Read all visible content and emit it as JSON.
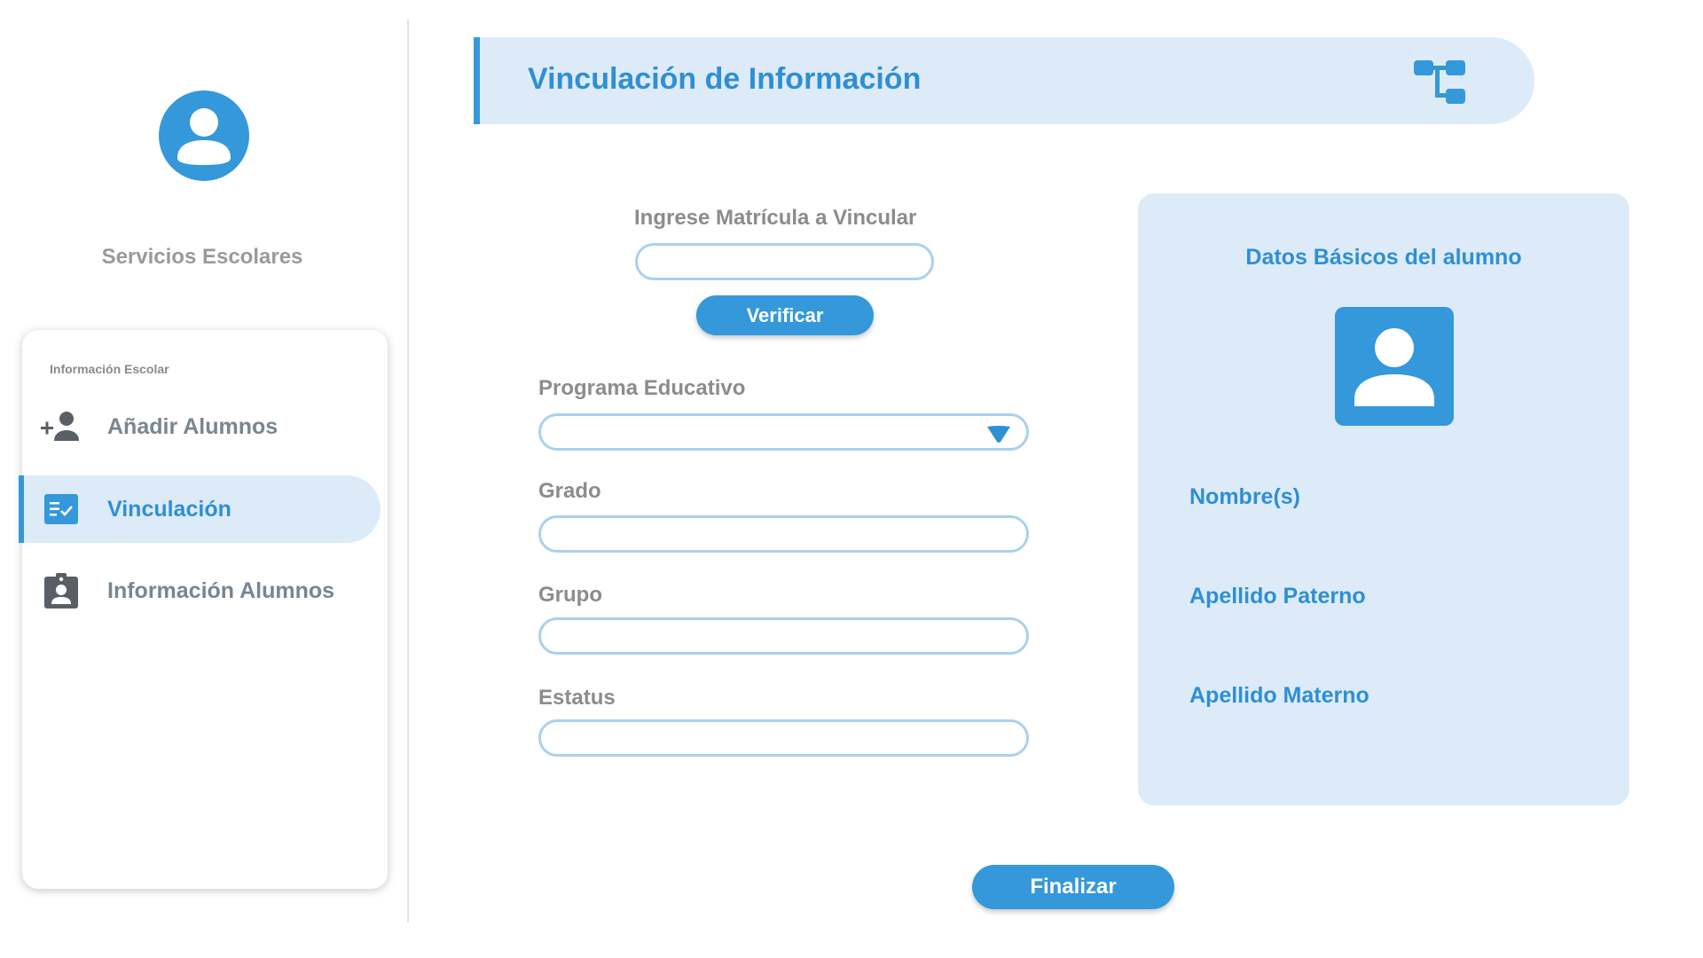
{
  "sidebar": {
    "app_name": "Servicios Escolares",
    "menu": {
      "section_title": "Información Escolar",
      "items": [
        {
          "label": "Añadir Alumnos",
          "icon": "add-person-icon",
          "active": false
        },
        {
          "label": "Vinculación",
          "icon": "checklist-icon",
          "active": true
        },
        {
          "label": "Información Alumnos",
          "icon": "badge-person-icon",
          "active": false
        }
      ]
    }
  },
  "header": {
    "title": "Vinculación de Información",
    "icon": "hierarchy-icon"
  },
  "form": {
    "matricula_label": "Ingrese Matrícula a Vincular",
    "matricula_value": "",
    "verify_button": "Verificar",
    "programa_label": "Programa Educativo",
    "programa_value": "",
    "grado_label": "Grado",
    "grado_value": "",
    "grupo_label": "Grupo",
    "grupo_value": "",
    "estatus_label": "Estatus",
    "estatus_value": "",
    "finish_button": "Finalizar"
  },
  "student_card": {
    "title": "Datos Básicos del alumno",
    "nombre_label": "Nombre(s)",
    "paterno_label": "Apellido Paterno",
    "materno_label": "Apellido Materno"
  },
  "colors": {
    "accent": "#3498db",
    "accent_text": "#2f8fd4",
    "panel_bg": "#ddebf8",
    "input_border": "#a9d1ef",
    "muted_text": "#8c8c8c"
  }
}
